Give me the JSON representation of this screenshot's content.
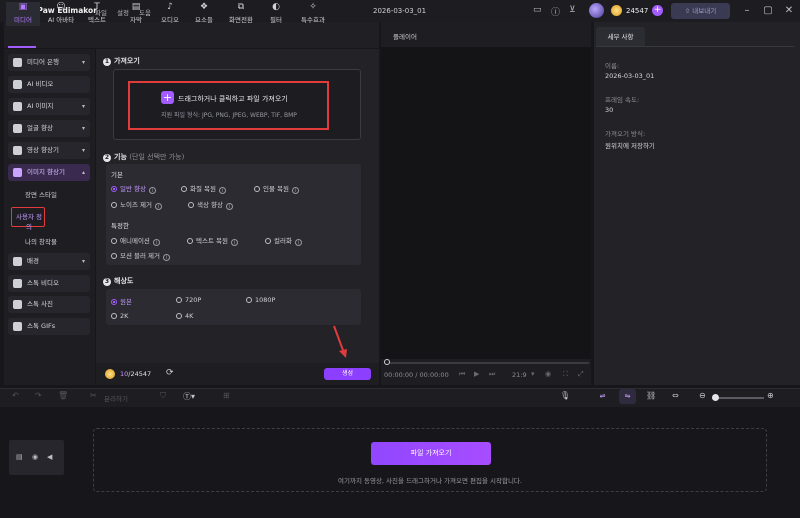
{
  "titlebar": {
    "app_name": "HitPaw Edimakor",
    "menu": [
      "파일",
      "설정",
      "도움"
    ],
    "project_name": "2026-03-03_01",
    "credits": "24547",
    "export_label": "내보내기"
  },
  "media_tabs": [
    {
      "label": "미디어",
      "icon": "folder-icon",
      "active": true
    },
    {
      "label": "AI 아바타",
      "icon": "avatar-icon"
    },
    {
      "label": "텍스트",
      "icon": "text-icon"
    },
    {
      "label": "자막",
      "icon": "subtitle-icon"
    },
    {
      "label": "오디오",
      "icon": "music-icon"
    },
    {
      "label": "요소들",
      "icon": "elements-icon"
    },
    {
      "label": "화면전환",
      "icon": "transition-icon"
    },
    {
      "label": "필터",
      "icon": "filter-icon"
    },
    {
      "label": "특수효과",
      "icon": "effects-icon"
    }
  ],
  "sidebar": {
    "items": [
      {
        "label": "미디어 은행",
        "caret": "▾"
      },
      {
        "label": "AI 비디오",
        "caret": ""
      },
      {
        "label": "AI 이미지",
        "caret": "▾"
      },
      {
        "label": "얼굴 향상",
        "caret": "▾"
      },
      {
        "label": "영상 향상기",
        "caret": "▾"
      },
      {
        "label": "이미지 향상기",
        "caret": "▴"
      },
      {
        "label": "배경",
        "caret": "▾"
      },
      {
        "label": "스톡 비디오",
        "caret": ""
      },
      {
        "label": "스톡 사진",
        "caret": ""
      },
      {
        "label": "스톡 GIFs",
        "caret": ""
      }
    ],
    "subitems": [
      "장면 스타일",
      "사용자 정의",
      "나의 창작물"
    ]
  },
  "center": {
    "import": {
      "heading": "가져오기",
      "button": "드래그하거나 클릭하고 파일 가져오기",
      "formats": "지원 파일 형식: JPG, PNG, JPEG, WEBP, TIF, BMP"
    },
    "function": {
      "heading": "기능",
      "note": "(단일 선택만 가능)",
      "basic_label": "기본",
      "basic_options": [
        "일반 향상",
        "화질 복원",
        "인물 복원",
        "노이즈 제거",
        "색상 향상"
      ],
      "special_label": "특정한",
      "special_options": [
        "애니메이션",
        "텍스트 복원",
        "컬러화",
        "모션 블러 제거"
      ]
    },
    "resolution": {
      "heading": "해상도",
      "options": [
        "원본",
        "720P",
        "1080P",
        "2K",
        "4K"
      ]
    },
    "credits_used": "10",
    "credits_total": "/24547",
    "generate_label": "생성"
  },
  "player": {
    "label": "플레이어",
    "timecode": "00:00:00 / 00:00:00",
    "ratio": "21:9"
  },
  "details": {
    "tab": "세부 사항",
    "name_label": "이름:",
    "name_value": "2026-03-03_01",
    "fps_label": "프레임 속도:",
    "fps_value": "30",
    "import_mode_label": "가져오기 방식:",
    "import_mode_value": "원위치에 저장하기"
  },
  "timeline": {
    "split_label": "분리하기",
    "zoom_level": 0.05,
    "import_label": "파일 가져오기",
    "drop_hint": "여기까지 동영상, 사진을 드래그하거나 가져오면 편집을 시작합니다."
  }
}
